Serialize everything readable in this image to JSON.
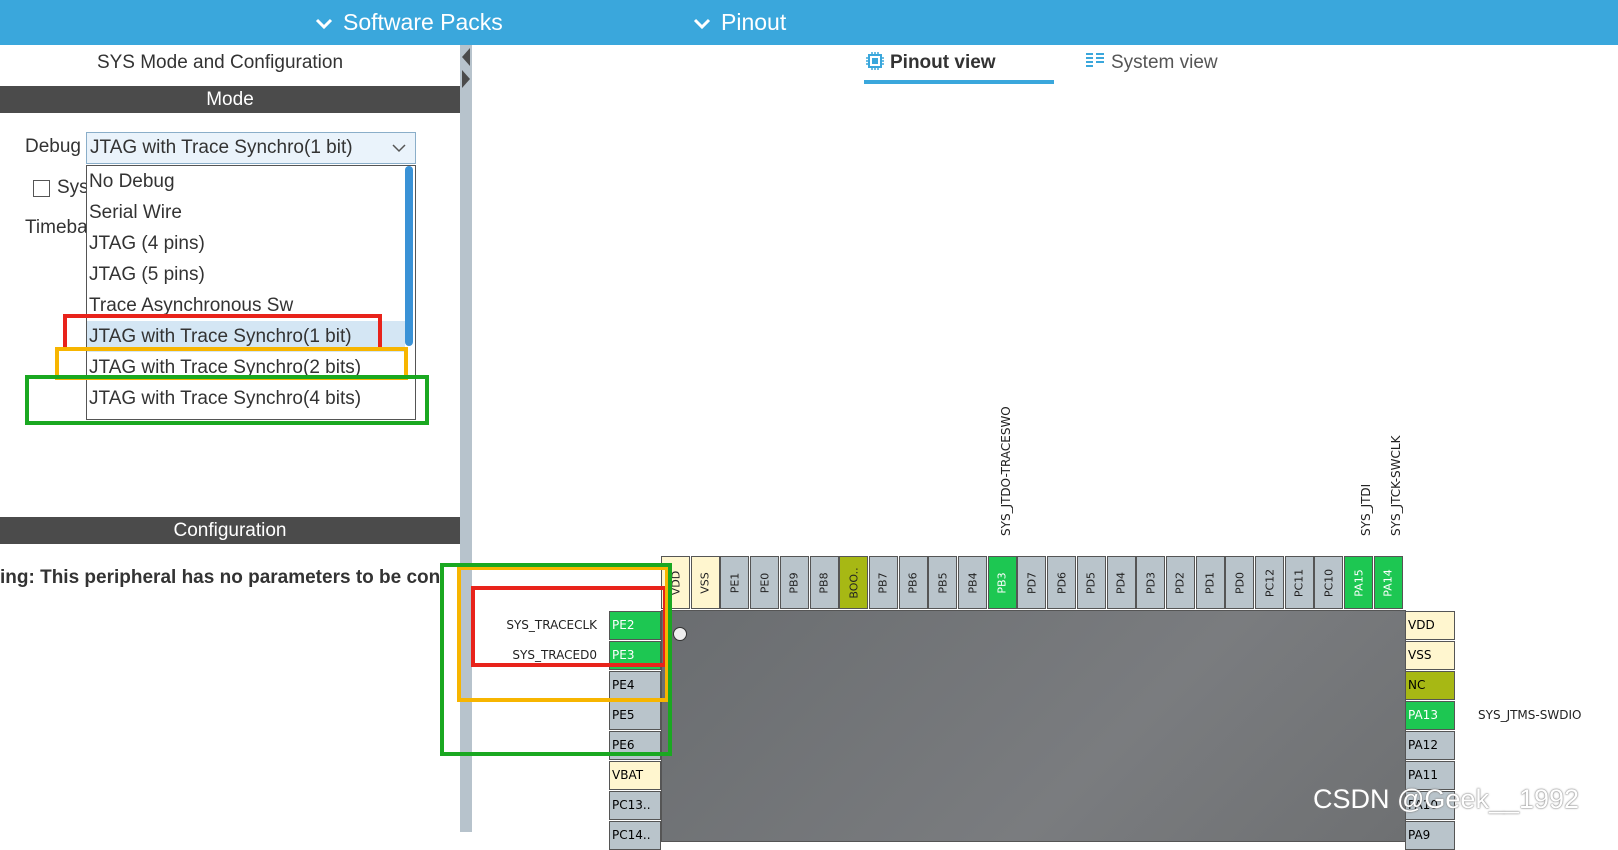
{
  "topbar": {
    "software_packs": "Software Packs",
    "pinout": "Pinout",
    "color": "#3aa7dc"
  },
  "left_panel": {
    "title": "SYS Mode and Configuration",
    "mode_header": "Mode",
    "debug_label": "Debug",
    "debug_value": "JTAG with Trace Synchro(1 bit)",
    "sys_checkbox_label": "Sys",
    "timebase_label": "Timeba",
    "debug_options": [
      "No Debug",
      "Serial Wire",
      "JTAG (4 pins)",
      "JTAG (5 pins)",
      "Trace Asynchronous Sw",
      "JTAG with Trace Synchro(1 bit)",
      "JTAG with Trace Synchro(2 bits)",
      "JTAG with Trace Synchro(4 bits)"
    ],
    "configuration_header": "Configuration",
    "warning": "ing: This peripheral has no parameters to be con"
  },
  "view_tabs": {
    "pinout_view": "Pinout view",
    "system_view": "System view"
  },
  "chip": {
    "top_pins": [
      {
        "name": "VDD",
        "type": "cream"
      },
      {
        "name": "VSS",
        "type": "cream"
      },
      {
        "name": "PE1",
        "type": "gray"
      },
      {
        "name": "PE0",
        "type": "gray"
      },
      {
        "name": "PB9",
        "type": "gray"
      },
      {
        "name": "PB8",
        "type": "gray"
      },
      {
        "name": "BOO..",
        "type": "olive"
      },
      {
        "name": "PB7",
        "type": "gray"
      },
      {
        "name": "PB6",
        "type": "gray"
      },
      {
        "name": "PB5",
        "type": "gray"
      },
      {
        "name": "PB4",
        "type": "gray"
      },
      {
        "name": "PB3",
        "type": "green"
      },
      {
        "name": "PD7",
        "type": "gray"
      },
      {
        "name": "PD6",
        "type": "gray"
      },
      {
        "name": "PD5",
        "type": "gray"
      },
      {
        "name": "PD4",
        "type": "gray"
      },
      {
        "name": "PD3",
        "type": "gray"
      },
      {
        "name": "PD2",
        "type": "gray"
      },
      {
        "name": "PD1",
        "type": "gray"
      },
      {
        "name": "PD0",
        "type": "gray"
      },
      {
        "name": "PC12",
        "type": "gray"
      },
      {
        "name": "PC11",
        "type": "gray"
      },
      {
        "name": "PC10",
        "type": "gray"
      },
      {
        "name": "PA15",
        "type": "green"
      },
      {
        "name": "PA14",
        "type": "green"
      }
    ],
    "left_pins": [
      {
        "name": "PE2",
        "type": "green",
        "signal": "SYS_TRACECLK"
      },
      {
        "name": "PE3",
        "type": "green",
        "signal": "SYS_TRACED0"
      },
      {
        "name": "PE4",
        "type": "gray",
        "signal": ""
      },
      {
        "name": "PE5",
        "type": "gray",
        "signal": ""
      },
      {
        "name": "PE6",
        "type": "gray",
        "signal": ""
      },
      {
        "name": "VBAT",
        "type": "cream",
        "signal": ""
      },
      {
        "name": "PC13..",
        "type": "gray",
        "signal": ""
      },
      {
        "name": "PC14..",
        "type": "gray",
        "signal": ""
      }
    ],
    "right_pins": [
      {
        "name": "VDD",
        "type": "cream",
        "signal": ""
      },
      {
        "name": "VSS",
        "type": "cream",
        "signal": ""
      },
      {
        "name": "NC",
        "type": "olive",
        "signal": ""
      },
      {
        "name": "PA13",
        "type": "green",
        "signal": "SYS_JTMS-SWDIO"
      },
      {
        "name": "PA12",
        "type": "gray",
        "signal": ""
      },
      {
        "name": "PA11",
        "type": "gray",
        "signal": ""
      },
      {
        "name": "PA10",
        "type": "gray",
        "signal": ""
      },
      {
        "name": "PA9",
        "type": "gray",
        "signal": ""
      }
    ],
    "top_signals": {
      "pb3": "SYS_JTDO-TRACESWO",
      "pa15": "SYS_JTDI",
      "pa14": "SYS_JTCK-SWCLK"
    }
  },
  "watermark": "CSDN @Geek__1992",
  "colors": {
    "pin_green": "#1dc752",
    "pin_gray": "#b9c4cb",
    "pin_olive": "#a7b814",
    "pin_cream": "#fff6cf",
    "highlight_red": "#e8231b",
    "highlight_orange": "#f7b500",
    "highlight_green": "#1aa821"
  }
}
